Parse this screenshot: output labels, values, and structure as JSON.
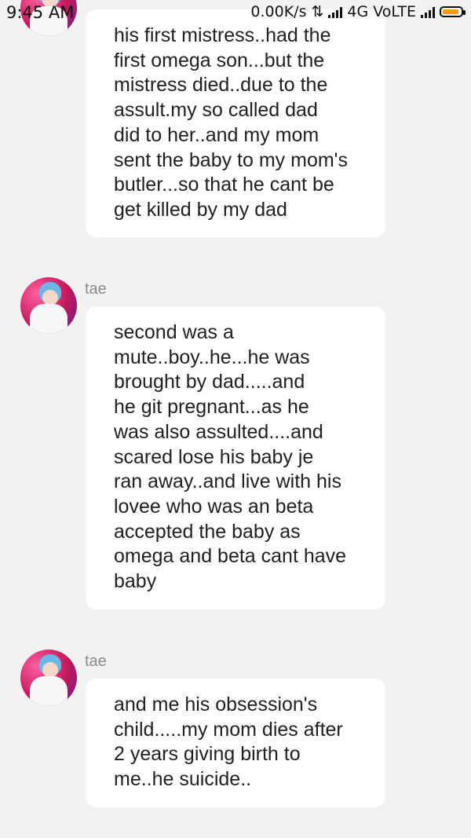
{
  "status_bar": {
    "time": "9:45 AM",
    "speed": "0.00K/s",
    "network": "4G VoLTE"
  },
  "messages": [
    {
      "text": "his first mistress..had the\nfirst omega son...but the\nmistress died..due to the\nassult.my so called dad\ndid to her..and my mom\nsent the baby to my mom's\nbutler...so that he cant be\nget killed by my dad"
    },
    {
      "author": "tae",
      "text": "second was a\nmute..boy..he...he was\nbrought by dad.....and\nhe git pregnant...as he\nwas also assulted....and\nscared lose his baby je\nran away..and live with his\nlovee who was an beta\naccepted the baby as\nomega and beta cant have\nbaby"
    },
    {
      "author": "tae",
      "text": "and me his obsession's\nchild.....my mom dies after\n2 years giving birth to\nme..he suicide.."
    }
  ]
}
